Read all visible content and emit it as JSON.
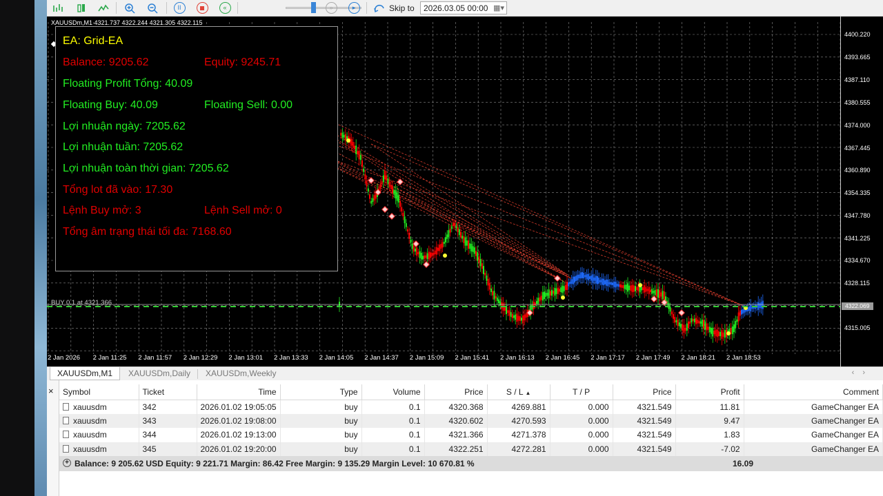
{
  "toolbar": {
    "skip_label": "Skip to",
    "date_value": "2026.03.05 00:00"
  },
  "chart": {
    "title": "XAUUSDm,M1  4321.737 4322.244 4321.305 4322.115",
    "current_price": "4322.069",
    "buy_line_label": "BUY 0.1 at 4321.366",
    "y_ticks": [
      "4400.220",
      "4393.665",
      "4387.110",
      "4380.555",
      "4374.000",
      "4367.445",
      "4360.890",
      "4354.335",
      "4347.780",
      "4341.225",
      "4334.670",
      "4328.115",
      "4315.005"
    ],
    "x_ticks": [
      "2 Jan 2026",
      "2 Jan 11:25",
      "2 Jan 11:57",
      "2 Jan 12:29",
      "2 Jan 13:01",
      "2 Jan 13:33",
      "2 Jan 14:05",
      "2 Jan 14:37",
      "2 Jan 15:09",
      "2 Jan 15:41",
      "2 Jan 16:13",
      "2 Jan 16:45",
      "2 Jan 17:17",
      "2 Jan 17:49",
      "2 Jan 18:21",
      "2 Jan 18:53"
    ],
    "colors": {
      "up": "#22ee22",
      "down": "#ff0000",
      "grid": "#8a8a8a",
      "buy_line": "#33cc33"
    }
  },
  "ea_panel": {
    "ea_name": "EA: Grid-EA",
    "balance": "Balance: 9205.62",
    "equity": "Equity: 9245.71",
    "floating_profit": "Floating Profit Tổng: 40.09",
    "floating_buy": "Floating Buy: 40.09",
    "floating_sell": "Floating Sell: 0.00",
    "profit_day": "Lợi nhuận ngày: 7205.62",
    "profit_week": "Lợi nhuận tuần: 7205.62",
    "profit_all": "Lợi nhuận toàn thời gian: 7205.62",
    "total_lot": "Tổng lot đã vào: 17.30",
    "buy_orders": "Lệnh Buy mở: 3",
    "sell_orders": "Lệnh Sell mở: 0",
    "max_drawdown": "Tổng âm trạng thái tối đa: 7168.60"
  },
  "tabs": [
    "XAUUSDm,M1",
    "XAUUSDm,Daily",
    "XAUUSDm,Weekly"
  ],
  "terminal": {
    "headers": [
      "Symbol",
      "Ticket",
      "Time",
      "Type",
      "Volume",
      "Price",
      "S / L",
      "T / P",
      "Price",
      "Profit",
      "Comment"
    ],
    "rows": [
      [
        "xauusdm",
        "342",
        "2026.01.02 19:05:05",
        "buy",
        "0.1",
        "4320.368",
        "4269.881",
        "0.000",
        "4321.549",
        "11.81",
        "GameChanger EA"
      ],
      [
        "xauusdm",
        "343",
        "2026.01.02 19:08:00",
        "buy",
        "0.1",
        "4320.602",
        "4270.593",
        "0.000",
        "4321.549",
        "9.47",
        "GameChanger EA"
      ],
      [
        "xauusdm",
        "344",
        "2026.01.02 19:13:00",
        "buy",
        "0.1",
        "4321.366",
        "4271.378",
        "0.000",
        "4321.549",
        "1.83",
        "GameChanger EA"
      ],
      [
        "xauusdm",
        "345",
        "2026.01.02 19:20:00",
        "buy",
        "0.1",
        "4322.251",
        "4272.281",
        "0.000",
        "4321.549",
        "-7.02",
        "GameChanger EA"
      ]
    ],
    "summary": "Balance: 9 205.62 USD  Equity: 9 221.71  Margin: 86.42  Free Margin: 9 135.29  Margin Level: 10 670.81 %",
    "total_profit": "16.09"
  }
}
